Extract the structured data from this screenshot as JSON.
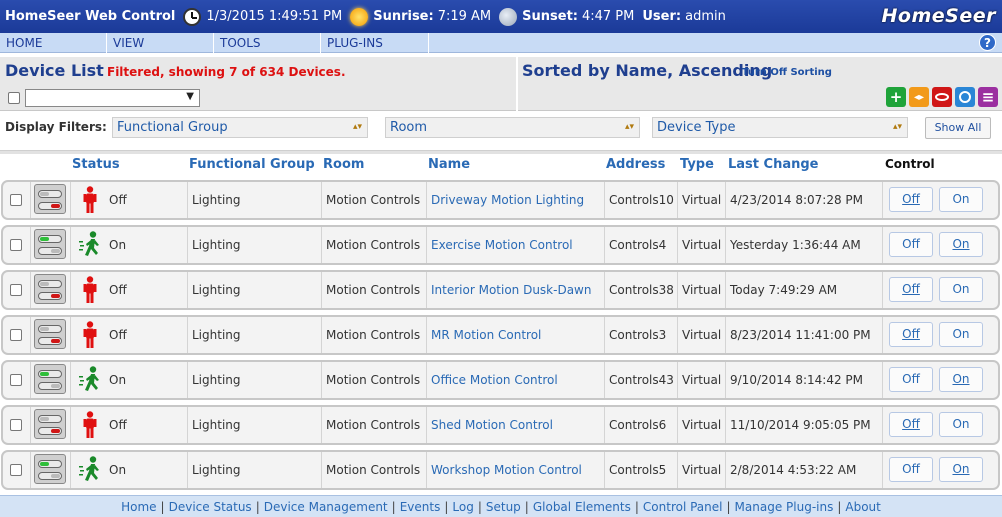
{
  "header": {
    "app_title": "HomeSeer Web Control",
    "datetime": "1/3/2015 1:49:51 PM",
    "sunrise_label": "Sunrise:",
    "sunrise_time": "7:19 AM",
    "sunset_label": "Sunset:",
    "sunset_time": "4:47 PM",
    "user_label": "User:",
    "user_name": "admin",
    "logo_text": "HomeSeer"
  },
  "menu": {
    "items": [
      "HOME",
      "VIEW",
      "TOOLS",
      "PLUG-INS"
    ],
    "help_icon": "?"
  },
  "device_list": {
    "title": "Device List",
    "filter_message": "Filtered, showing 7 of 634 Devices.",
    "sort_title": "Sorted by Name, Ascending",
    "sort_link": "Turn Off Sorting",
    "select_value": "",
    "toolbar_icons": [
      {
        "name": "add-icon",
        "color": "#1fa33a",
        "glyph": "+"
      },
      {
        "name": "arrows-icon",
        "color": "#f29a1a",
        "glyph": "◂▸"
      },
      {
        "name": "ring-icon",
        "color": "#d01616",
        "glyph": ""
      },
      {
        "name": "wireless-icon",
        "color": "#2a86d6",
        "glyph": ""
      },
      {
        "name": "list-icon",
        "color": "#9b2fa0",
        "glyph": "≡"
      }
    ]
  },
  "filters": {
    "label": "Display Filters:",
    "functional_group": "Functional Group",
    "room": "Room",
    "device_type": "Device Type",
    "show_all": "Show All"
  },
  "table": {
    "headers": {
      "status": "Status",
      "functional_group": "Functional Group",
      "room": "Room",
      "name": "Name",
      "address": "Address",
      "type": "Type",
      "last_change": "Last Change",
      "control": "Control"
    },
    "rows": [
      {
        "status": "Off",
        "group": "Lighting",
        "room": "Motion Controls",
        "name": "Driveway Motion Lighting",
        "address": "Controls10",
        "type": "Virtual",
        "last_change": "4/23/2014 8:07:28 PM",
        "off": "Off",
        "on": "On"
      },
      {
        "status": "On",
        "group": "Lighting",
        "room": "Motion Controls",
        "name": "Exercise Motion Control",
        "address": "Controls4",
        "type": "Virtual",
        "last_change": "Yesterday 1:36:44 AM",
        "off": "Off",
        "on": "On"
      },
      {
        "status": "Off",
        "group": "Lighting",
        "room": "Motion Controls",
        "name": "Interior Motion Dusk-Dawn",
        "address": "Controls38",
        "type": "Virtual",
        "last_change": "Today 7:49:29 AM",
        "off": "Off",
        "on": "On"
      },
      {
        "status": "Off",
        "group": "Lighting",
        "room": "Motion Controls",
        "name": "MR Motion Control",
        "address": "Controls3",
        "type": "Virtual",
        "last_change": "8/23/2014 11:41:00 PM",
        "off": "Off",
        "on": "On"
      },
      {
        "status": "On",
        "group": "Lighting",
        "room": "Motion Controls",
        "name": "Office Motion Control",
        "address": "Controls43",
        "type": "Virtual",
        "last_change": "9/10/2014 8:14:42 PM",
        "off": "Off",
        "on": "On"
      },
      {
        "status": "Off",
        "group": "Lighting",
        "room": "Motion Controls",
        "name": "Shed Motion Control",
        "address": "Controls6",
        "type": "Virtual",
        "last_change": "11/10/2014 9:05:05 PM",
        "off": "Off",
        "on": "On"
      },
      {
        "status": "On",
        "group": "Lighting",
        "room": "Motion Controls",
        "name": "Workshop Motion Control",
        "address": "Controls5",
        "type": "Virtual",
        "last_change": "2/8/2014 4:53:22 AM",
        "off": "Off",
        "on": "On"
      }
    ]
  },
  "footer": {
    "links": [
      "Home",
      "Device Status",
      "Device Management",
      "Events",
      "Log",
      "Setup",
      "Global Elements",
      "Control Panel",
      "Manage Plug-ins",
      "About"
    ]
  },
  "colors": {
    "title_bar": "#1b3a98",
    "menu_bar": "#c8dbf5",
    "link_blue": "#2a6ab5",
    "filter_red": "#dd1111",
    "status_off_red": "#e01010",
    "status_on_green": "#1a8a2a"
  }
}
